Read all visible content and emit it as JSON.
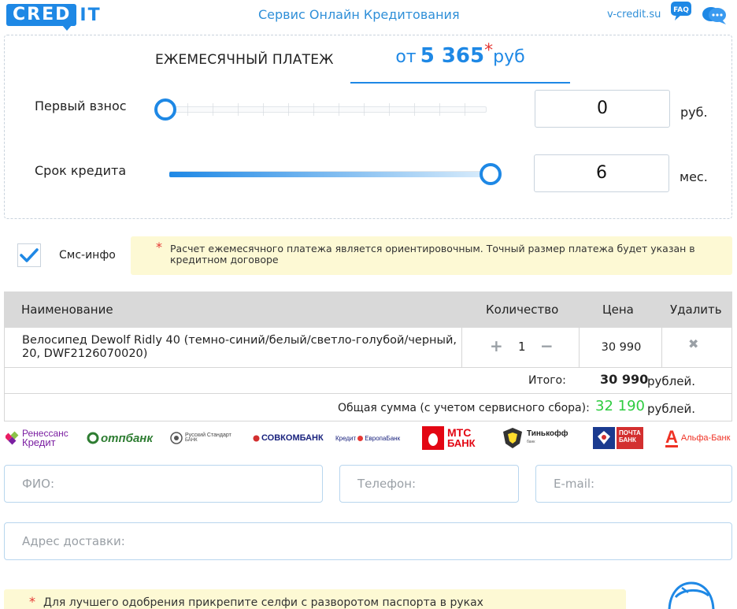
{
  "header": {
    "logo_box": "CRED",
    "logo_rest": "IT",
    "title": "Сервис Онлайн Кредитования",
    "site": "v-credit.su",
    "faq_icon": "faq-speech-bubble-icon",
    "chat_icon": "chat-bubbles-icon",
    "faq_text": "FAQ"
  },
  "calculator": {
    "monthly_label": "ЕЖЕМЕСЯЧНЫЙ ПЛАТЕЖ",
    "monthly_prefix": "от",
    "monthly_amount": "5 365",
    "monthly_star": "*",
    "monthly_currency": "руб",
    "down_payment": {
      "label": "Первый взнос",
      "value": "0",
      "unit": "руб.",
      "slider_fraction": 0
    },
    "term": {
      "label": "Срок кредита",
      "value": "6",
      "unit": "мес.",
      "slider_fraction": 1
    }
  },
  "sms": {
    "label": "Смс-инфо",
    "checked": true
  },
  "note": {
    "star": "*",
    "text": "Расчет ежемесячного платежа является ориентировочным. Точный размер платежа будет указан в кредитном договоре"
  },
  "cart": {
    "headers": {
      "name": "Наименование",
      "qty": "Количество",
      "price": "Цена",
      "delete": "Удалить"
    },
    "items": [
      {
        "name": "Велосипед Dewolf Ridly 40 (темно-синий/белый/светло-голубой/черный, 20, DWF2126070020)",
        "plus": "+",
        "qty": "1",
        "minus": "−",
        "price": "30 990",
        "delete": "✖"
      }
    ],
    "total": {
      "label": "Итого:",
      "value": "30 990",
      "currency": "рублей."
    },
    "grand_total": {
      "label": "Общая сумма (с учетом сервисного сбора):",
      "value": "32 190",
      "currency": "рублей."
    },
    "colors": {
      "grand_total": "#2ecc40"
    }
  },
  "banks": [
    {
      "top": "Ренессанс",
      "bottom": "Кредит"
    },
    {
      "name": "отпбанк"
    },
    {
      "top": "Русский Стандарт",
      "bottom": "БАНК"
    },
    {
      "name": "СОВКОМБАНК"
    },
    {
      "name": "Кредит",
      "suffix": "ЕвропаБанк"
    },
    {
      "top": "МТС",
      "bottom": "БАНК"
    },
    {
      "name": "Тинькофф",
      "sub": "банк"
    },
    {
      "top": "ПОЧТА",
      "bottom": "БАНК"
    },
    {
      "name": "Альфа-Банк",
      "glyph": "А"
    }
  ],
  "form": {
    "fio": "ФИО:",
    "phone": "Телефон:",
    "email": "E-mail:",
    "address": "Адрес доставки:"
  },
  "bottom_note": {
    "star": "*",
    "text": "Для лучшего одобрения прикрепите селфи с разворотом паспорта в руках"
  }
}
